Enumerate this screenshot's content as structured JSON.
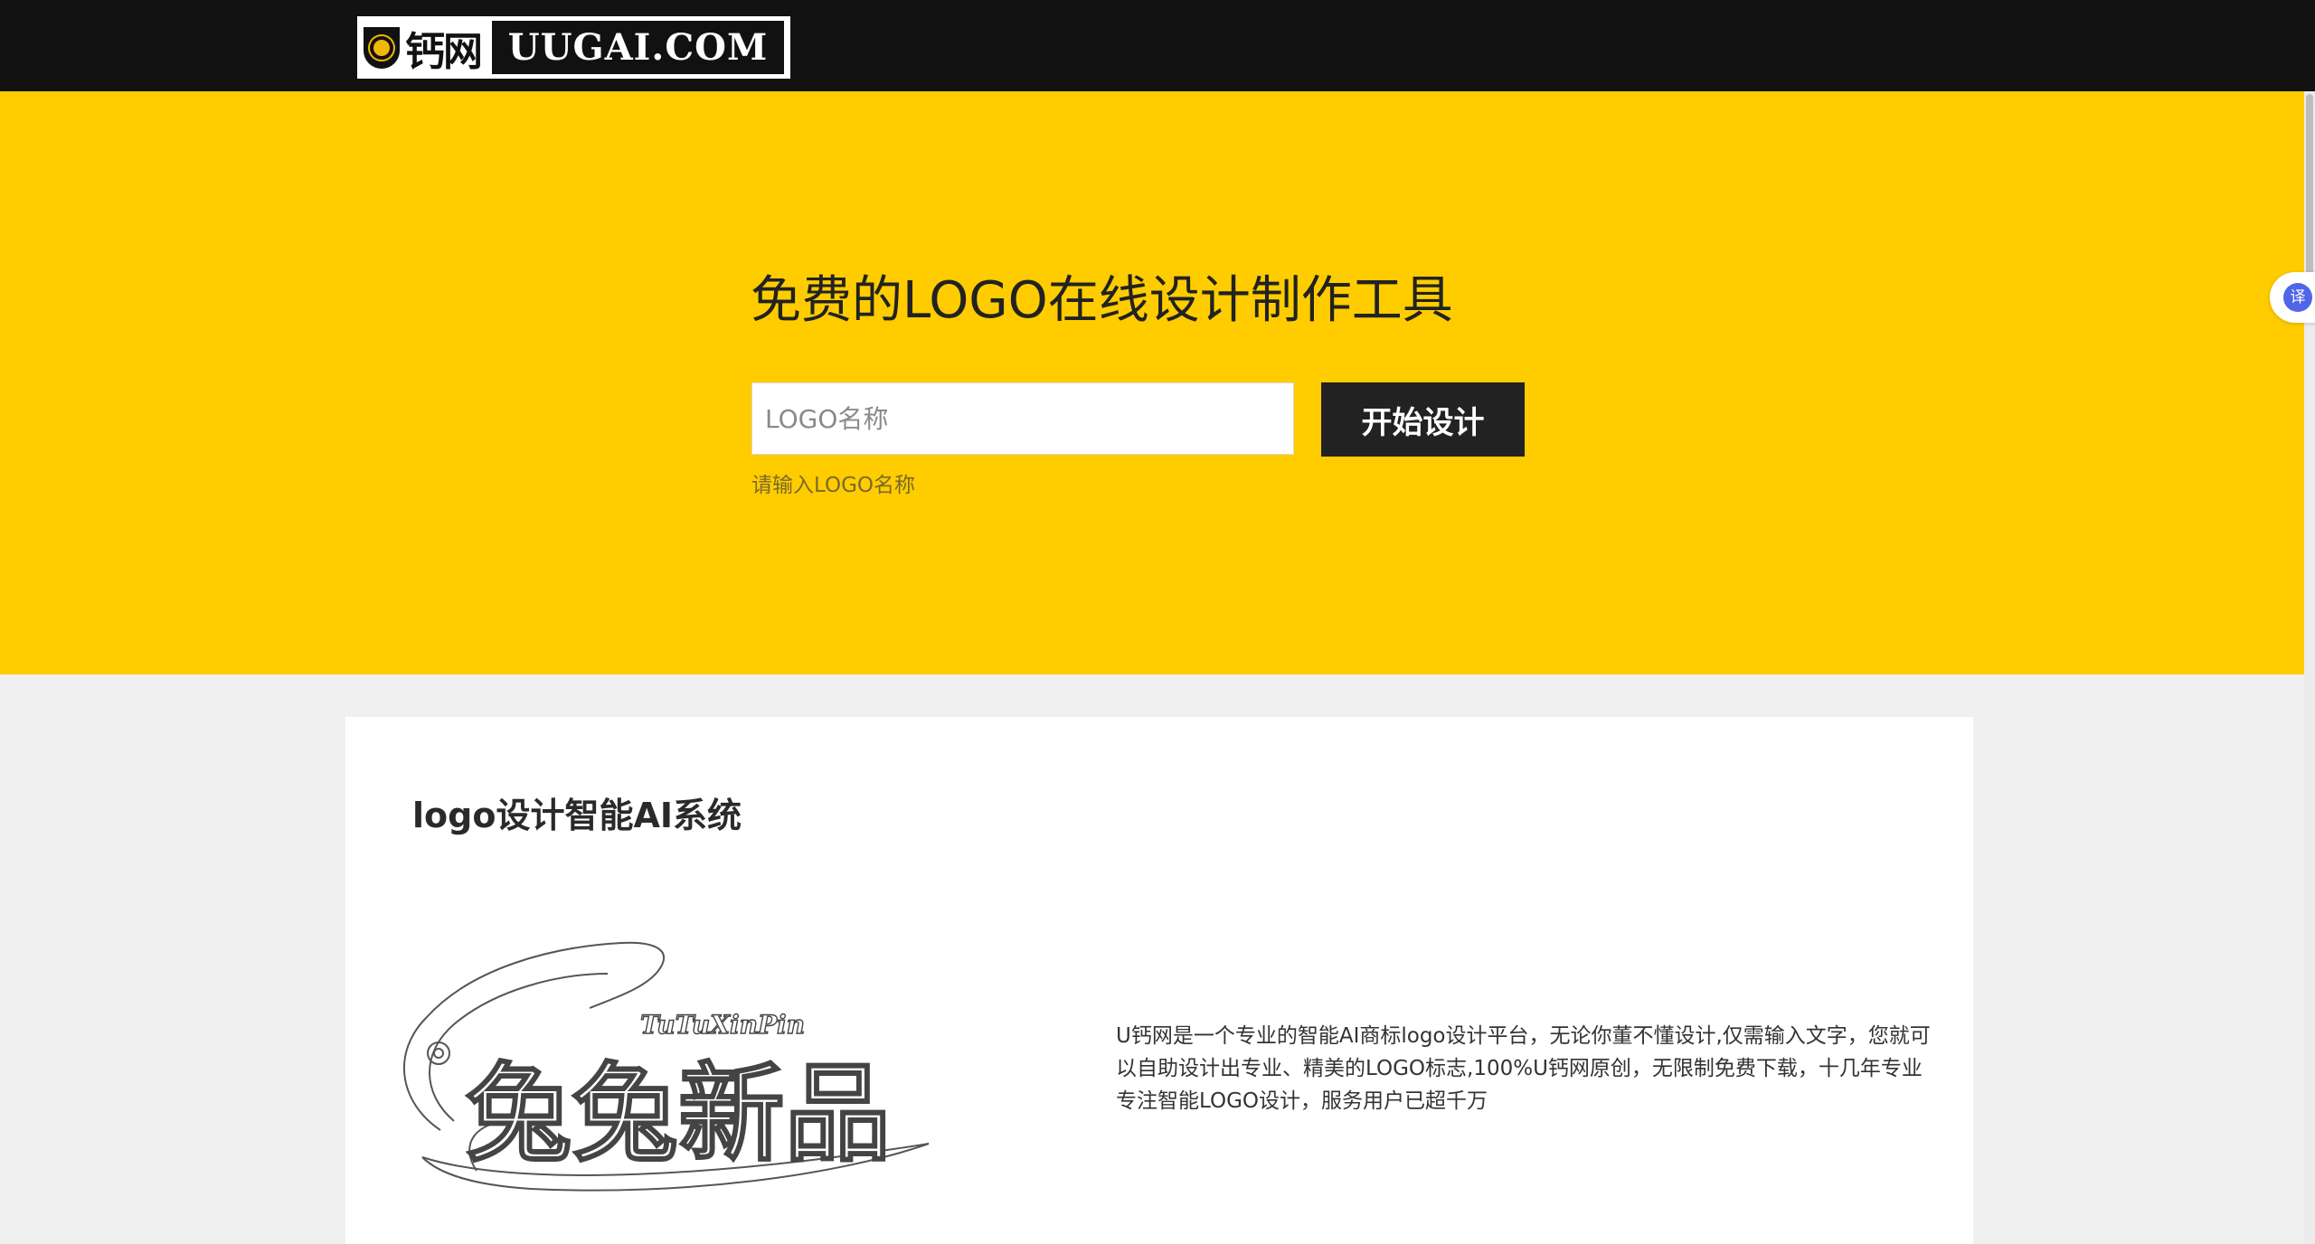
{
  "header": {
    "brand_mark": "钙网",
    "brand_domain": "UUGAI.COM"
  },
  "hero": {
    "title": "免费的LOGO在线设计制作工具",
    "input_placeholder": "LOGO名称",
    "button_label": "开始设计",
    "hint": "请输入LOGO名称"
  },
  "translate_widget": {
    "label": "译"
  },
  "section": {
    "title": "logo设计智能AI系统",
    "description": "U钙网是一个专业的智能AI商标logo设计平台，无论你董不懂设计,仅需输入文字，您就可以自助设计出专业、精美的LOGO标志,100%U钙网原创，无限制免费下载，十几年专业专注智能LOGO设计，服务用户已超千万",
    "example_logo": {
      "pinyin": "TuTuXinPin",
      "chinese": "兔兔新品"
    }
  },
  "colors": {
    "header_bg": "#121212",
    "hero_bg": "#ffcc00",
    "button_bg": "#222222",
    "page_bg": "#f0f0f0",
    "card_bg": "#ffffff",
    "translate_accent": "#4f66e8"
  }
}
